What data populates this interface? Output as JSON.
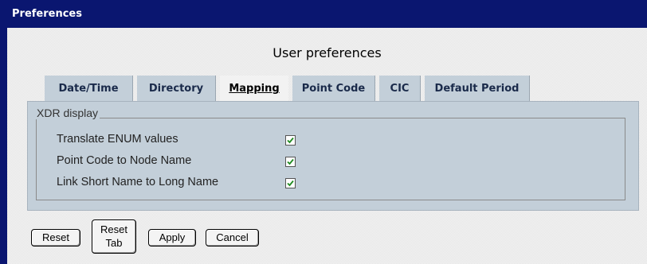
{
  "window": {
    "title": "Preferences"
  },
  "page": {
    "subtitle": "User preferences"
  },
  "tabs": [
    {
      "label": "Date/Time"
    },
    {
      "label": "Directory"
    },
    {
      "label": "Mapping",
      "active": true
    },
    {
      "label": "Point Code"
    },
    {
      "label": "CIC"
    },
    {
      "label": "Default Period"
    }
  ],
  "xdr_display": {
    "legend": "XDR display",
    "options": [
      {
        "label": "Translate ENUM values",
        "checked": true
      },
      {
        "label": "Point Code to Node Name",
        "checked": true
      },
      {
        "label": "Link Short Name to Long Name",
        "checked": true
      }
    ]
  },
  "buttons": {
    "reset": "Reset",
    "reset_tab_line1": "Reset",
    "reset_tab_line2": "Tab",
    "apply": "Apply",
    "cancel": "Cancel"
  },
  "colors": {
    "titlebar": "#0a1670",
    "tab_background": "#c3cfd9",
    "checkmark": "#1f8a1f"
  }
}
